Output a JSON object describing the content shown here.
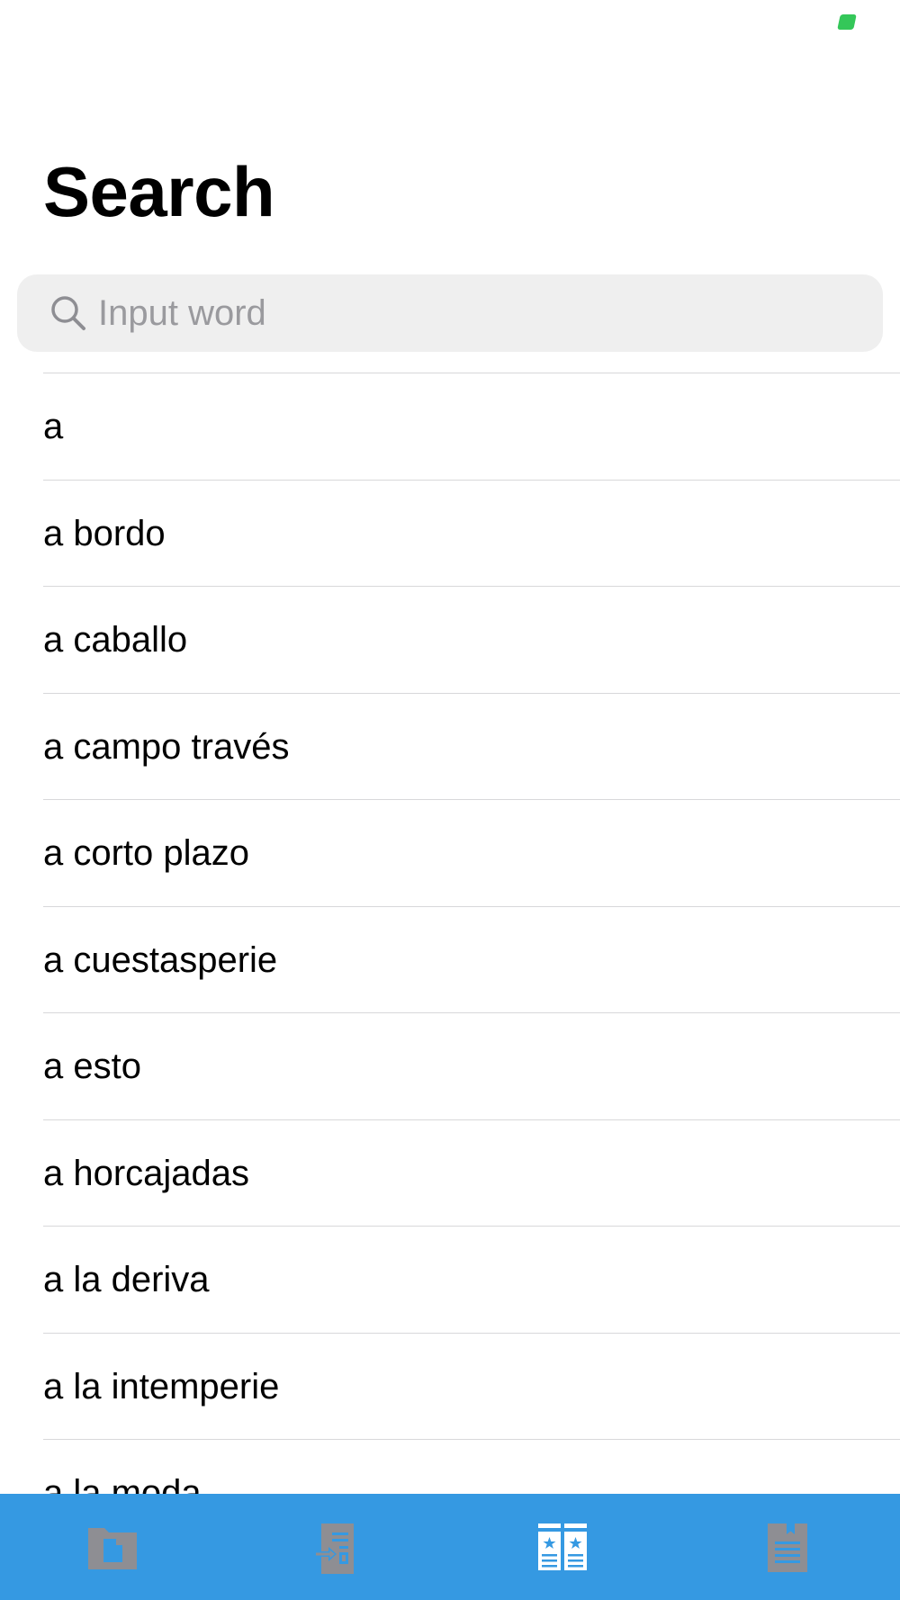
{
  "page": {
    "title": "Search"
  },
  "search": {
    "placeholder": "Input word",
    "value": ""
  },
  "results": [
    {
      "label": "a"
    },
    {
      "label": "a bordo"
    },
    {
      "label": "a caballo"
    },
    {
      "label": "a campo través"
    },
    {
      "label": "a corto plazo"
    },
    {
      "label": "a cuestasperie"
    },
    {
      "label": "a esto"
    },
    {
      "label": "a horcajadas"
    },
    {
      "label": "a la deriva"
    },
    {
      "label": "a la intemperie"
    },
    {
      "label": "a la moda"
    }
  ],
  "tab_bar": {
    "tabs": [
      {
        "icon": "folder-document-icon",
        "selected": false
      },
      {
        "icon": "import-document-icon",
        "selected": false
      },
      {
        "icon": "starred-dictionary-icon",
        "selected": true
      },
      {
        "icon": "bookmark-document-icon",
        "selected": false
      }
    ]
  },
  "colors": {
    "tab_bar_background": "#3599e2",
    "tab_icon_inactive": "#8e8e93",
    "tab_icon_active": "#ffffff",
    "status_indicator": "#34c759",
    "search_background": "#efefef",
    "placeholder": "#9a9a9e",
    "separator": "#d8d8da"
  }
}
